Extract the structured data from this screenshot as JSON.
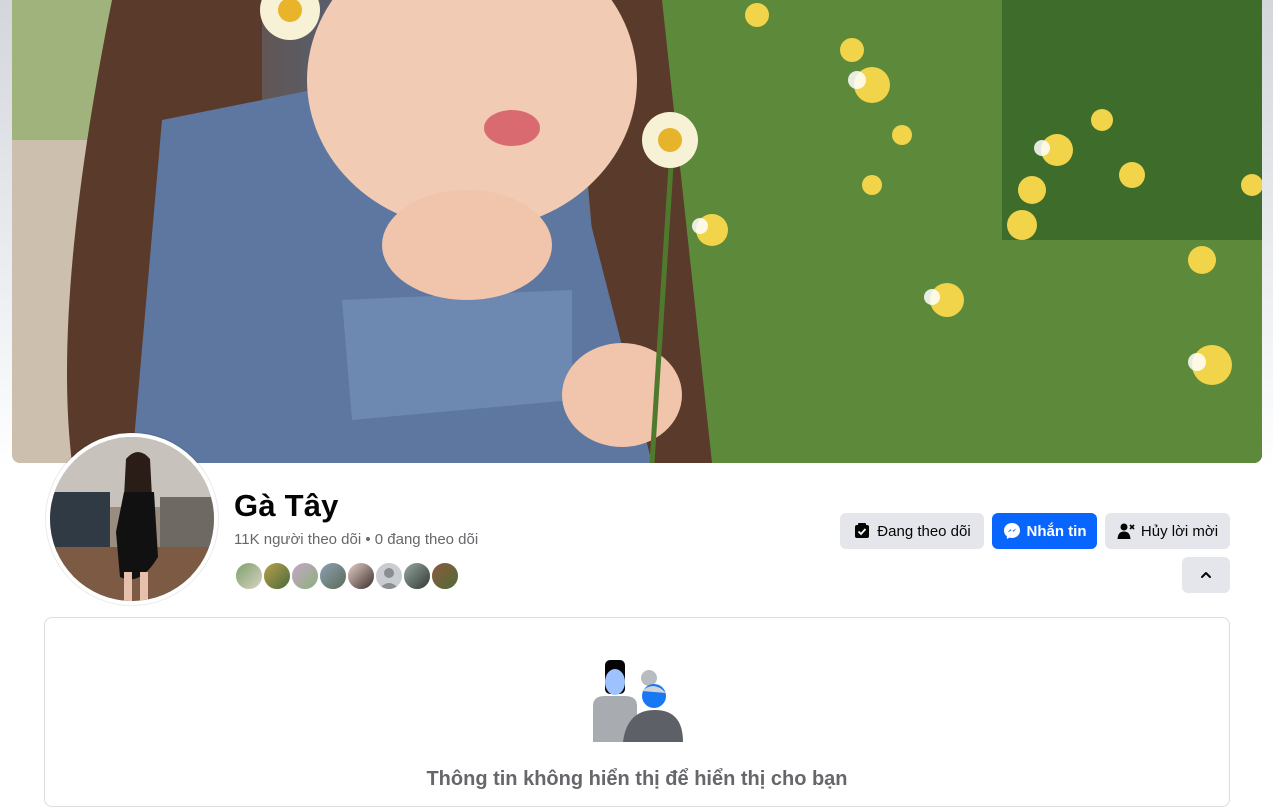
{
  "profile": {
    "name": "Gà Tây",
    "followers_line": "11K người theo dõi • 0 đang theo dõi",
    "mutual_friend_count_shown": 8
  },
  "actions": {
    "following_label": "Đang theo dõi",
    "message_label": "Nhắn tin",
    "cancel_invite_label": "Hủy lời mời",
    "collapse_icon": "chevron-up-icon"
  },
  "card": {
    "empty_message": "Thông tin không hiển thị để hiển thị cho bạn"
  },
  "colors": {
    "accent": "#0866ff",
    "button_gray": "#e4e6eb",
    "secondary_text": "#65676b"
  }
}
